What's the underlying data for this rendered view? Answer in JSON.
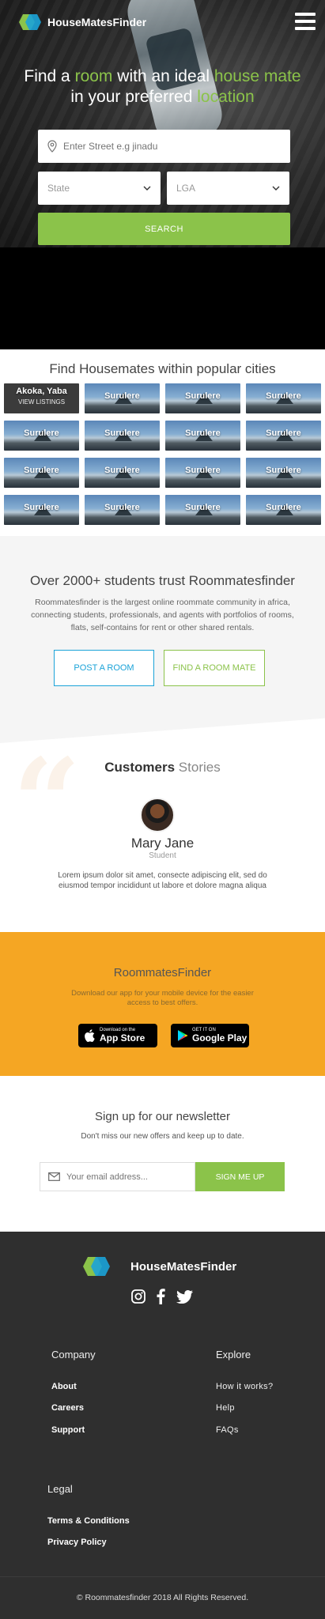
{
  "brand": {
    "name": "HouseMatesFinder"
  },
  "hero": {
    "title_parts": [
      "Find a ",
      "room",
      " with an ideal ",
      "house mate",
      " in your preferred ",
      "location"
    ],
    "search_placeholder": "Enter Street e.g jinadu",
    "state_label": "State",
    "lga_label": "LGA",
    "search_button": "SEARCH"
  },
  "cities": {
    "title": "Find Housemates within popular cities",
    "items": [
      {
        "name": "Akoka, Yaba",
        "sub": "VIEW LISTINGS"
      },
      {
        "name": "Surulere"
      },
      {
        "name": "Surulere"
      },
      {
        "name": "Surulere"
      },
      {
        "name": "Surulere"
      },
      {
        "name": "Surulere"
      },
      {
        "name": "Surulere"
      },
      {
        "name": "Surulere"
      },
      {
        "name": "Surulere"
      },
      {
        "name": "Surulere"
      },
      {
        "name": "Surulere"
      },
      {
        "name": "Surulere"
      },
      {
        "name": "Surulere"
      },
      {
        "name": "Surulere"
      },
      {
        "name": "Surulere"
      },
      {
        "name": "Surulere"
      }
    ]
  },
  "trust": {
    "title": "Over 2000+ students trust Roommatesfinder",
    "text": "Roommatesfinder is the largest online roommate community in africa, connecting students, professionals, and agents with portfolios of rooms, flats, self-contains for rent or other shared rentals.",
    "post_button": "POST A ROOM",
    "find_button": "FIND A ROOM MATE"
  },
  "stories": {
    "title_bold": "Customers",
    "title_light": " Stories",
    "name": "Mary Jane",
    "role": "Student",
    "text": "Lorem ipsum dolor sit amet, consecte adipiscing elit, sed do eiusmod tempor incididunt ut labore et dolore magna aliqua"
  },
  "app": {
    "title": "RoommatesFinder",
    "text": "Download our app for your mobile device for the easier access to best offers.",
    "apple_small": "Download on the",
    "apple_big": "App Store",
    "google_small": "GET IT ON",
    "google_big": "Google Play"
  },
  "newsletter": {
    "title": "Sign up for our newsletter",
    "text": "Don't miss our new offers and keep up to date.",
    "placeholder": "Your email address...",
    "button": "SIGN ME UP"
  },
  "footer": {
    "brand": "HouseMatesFinder",
    "company_title": "Company",
    "company_links": [
      "About",
      "Careers",
      "Support"
    ],
    "explore_title": "Explore",
    "explore_links": [
      "How it works?",
      "Help",
      "FAQs"
    ],
    "legal_title": "Legal",
    "legal_links": [
      "Terms & Conditions",
      "Privacy Policy"
    ],
    "copyright": "© Roommatesfinder 2018 All Rights Reserved."
  },
  "colors": {
    "green": "#8bc34a",
    "blue": "#1ba3d8",
    "orange": "#f5a623",
    "footer": "#2f2f2f"
  }
}
